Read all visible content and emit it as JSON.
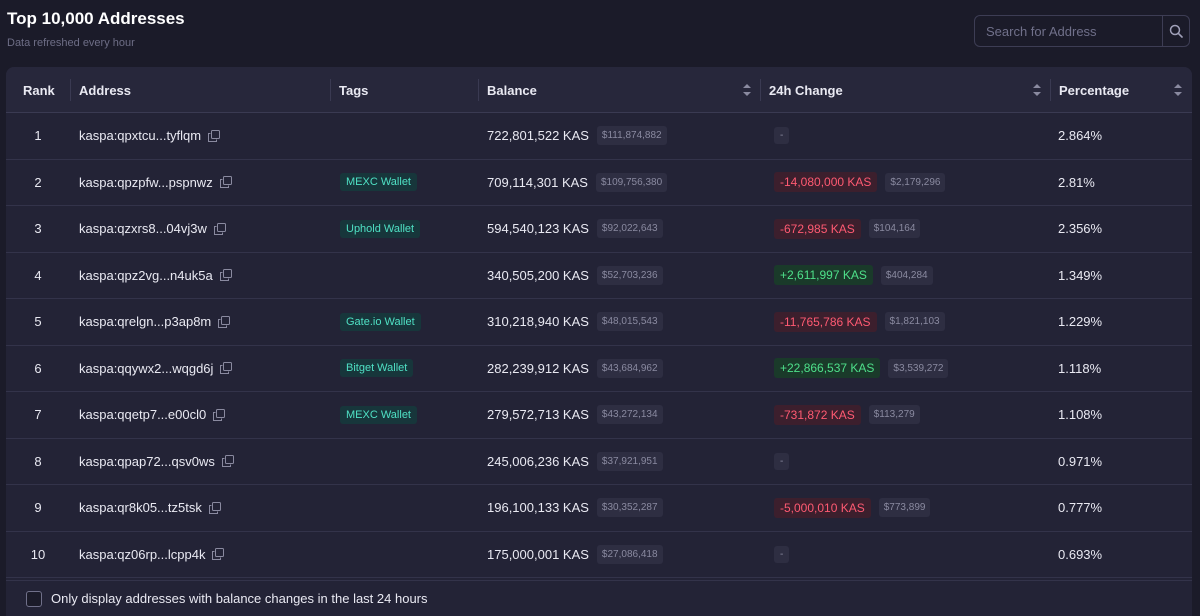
{
  "header": {
    "title": "Top 10,000 Addresses",
    "subtitle": "Data refreshed every hour"
  },
  "search": {
    "placeholder": "Search for Address",
    "icon": "search-icon"
  },
  "columns": {
    "rank": "Rank",
    "address": "Address",
    "tags": "Tags",
    "balance": "Balance",
    "change": "24h Change",
    "percentage": "Percentage"
  },
  "rows": [
    {
      "rank": "1",
      "address": "kaspa:qpxtcu...tyflqm",
      "tag": "",
      "balance": "722,801,522 KAS",
      "balance_usd": "$111,874,882",
      "change": "-",
      "change_usd": "",
      "change_dir": "none",
      "percentage": "2.864%"
    },
    {
      "rank": "2",
      "address": "kaspa:qpzpfw...pspnwz",
      "tag": "MEXC Wallet",
      "balance": "709,114,301 KAS",
      "balance_usd": "$109,756,380",
      "change": "-14,080,000 KAS",
      "change_usd": "$2,179,296",
      "change_dir": "neg",
      "percentage": "2.81%"
    },
    {
      "rank": "3",
      "address": "kaspa:qzxrs8...04vj3w",
      "tag": "Uphold Wallet",
      "balance": "594,540,123 KAS",
      "balance_usd": "$92,022,643",
      "change": "-672,985 KAS",
      "change_usd": "$104,164",
      "change_dir": "neg",
      "percentage": "2.356%"
    },
    {
      "rank": "4",
      "address": "kaspa:qpz2vg...n4uk5a",
      "tag": "",
      "balance": "340,505,200 KAS",
      "balance_usd": "$52,703,236",
      "change": "+2,611,997 KAS",
      "change_usd": "$404,284",
      "change_dir": "pos",
      "percentage": "1.349%"
    },
    {
      "rank": "5",
      "address": "kaspa:qrelgn...p3ap8m",
      "tag": "Gate.io Wallet",
      "balance": "310,218,940 KAS",
      "balance_usd": "$48,015,543",
      "change": "-11,765,786 KAS",
      "change_usd": "$1,821,103",
      "change_dir": "neg",
      "percentage": "1.229%"
    },
    {
      "rank": "6",
      "address": "kaspa:qqywx2...wqgd6j",
      "tag": "Bitget Wallet",
      "balance": "282,239,912 KAS",
      "balance_usd": "$43,684,962",
      "change": "+22,866,537 KAS",
      "change_usd": "$3,539,272",
      "change_dir": "pos",
      "percentage": "1.118%"
    },
    {
      "rank": "7",
      "address": "kaspa:qqetp7...e00cl0",
      "tag": "MEXC Wallet",
      "balance": "279,572,713 KAS",
      "balance_usd": "$43,272,134",
      "change": "-731,872 KAS",
      "change_usd": "$113,279",
      "change_dir": "neg",
      "percentage": "1.108%"
    },
    {
      "rank": "8",
      "address": "kaspa:qpap72...qsv0ws",
      "tag": "",
      "balance": "245,006,236 KAS",
      "balance_usd": "$37,921,951",
      "change": "-",
      "change_usd": "",
      "change_dir": "none",
      "percentage": "0.971%"
    },
    {
      "rank": "9",
      "address": "kaspa:qr8k05...tz5tsk",
      "tag": "",
      "balance": "196,100,133 KAS",
      "balance_usd": "$30,352,287",
      "change": "-5,000,010 KAS",
      "change_usd": "$773,899",
      "change_dir": "neg",
      "percentage": "0.777%"
    },
    {
      "rank": "10",
      "address": "kaspa:qz06rp...lcpp4k",
      "tag": "",
      "balance": "175,000,001 KAS",
      "balance_usd": "$27,086,418",
      "change": "-",
      "change_usd": "",
      "change_dir": "none",
      "percentage": "0.693%"
    }
  ],
  "footer": {
    "checkbox_label": "Only display addresses with balance changes in the last 24 hours",
    "checked": false
  },
  "colors": {
    "background": "#1b1b29",
    "tag_text": "#4fe0c4",
    "negative": "#ff5a72",
    "positive": "#4ee08a"
  }
}
